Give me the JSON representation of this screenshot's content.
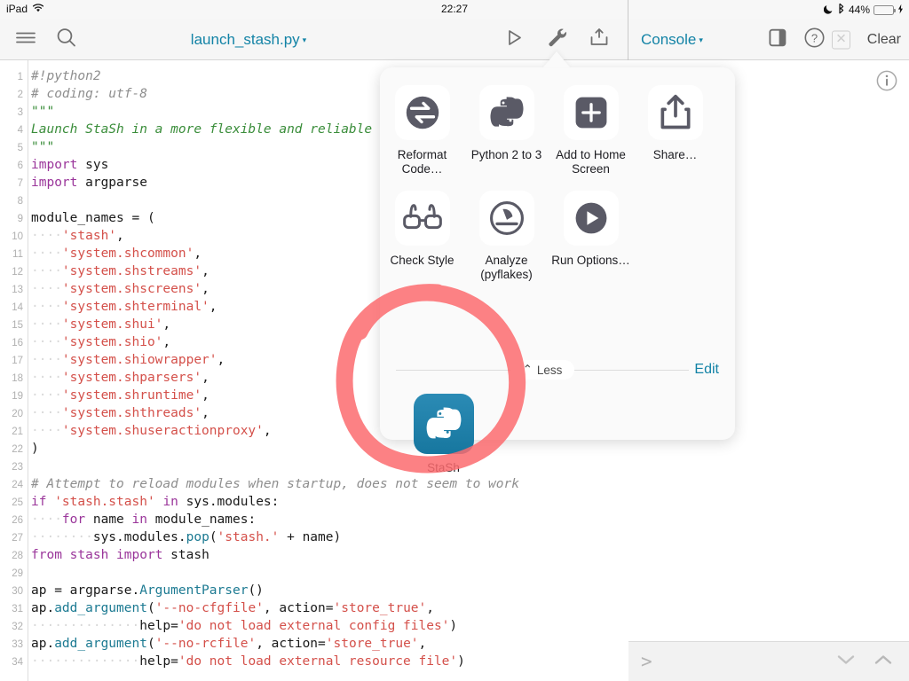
{
  "status_bar": {
    "device": "iPad",
    "wifi_icon": "wifi-icon",
    "time": "22:27",
    "dnd_icon": "moon-icon",
    "bluetooth_icon": "bluetooth-icon",
    "battery_percent": "44%",
    "battery_level": 44,
    "battery_color": "#4cd964",
    "charging_icon": "lightning-bolt-icon"
  },
  "toolbar": {
    "menu_icon": "hamburger-menu-icon",
    "search_icon": "search-icon",
    "document_title": "launch_stash.py",
    "title_caret": "▾",
    "run_icon": "play-triangle-icon",
    "wrench_icon": "wrench-icon",
    "export_icon": "add-to-tray-icon",
    "console_title": "Console",
    "console_caret": "▾",
    "panel_toggle_icon": "sidebar-toggle-icon",
    "help_icon": "question-mark-circle-icon",
    "close_icon": "x-box-icon",
    "clear_label": "Clear",
    "accent_color": "#1383a6"
  },
  "console": {
    "info_icon": "info-circle-icon",
    "prompt": ">",
    "history_down_icon": "chevron-down-icon",
    "history_up_icon": "chevron-up-icon"
  },
  "popover": {
    "actions": [
      {
        "label": "Reformat Code…",
        "icon": "reformat-arrows-icon"
      },
      {
        "label": "Python 2 to 3",
        "icon": "python-logo-icon"
      },
      {
        "label": "Add to Home Screen",
        "icon": "plus-square-icon"
      },
      {
        "label": "Share…",
        "icon": "share-upload-icon"
      },
      {
        "label": "Check Style",
        "icon": "glasses-icon"
      },
      {
        "label": "Analyze (pyflakes)",
        "icon": "gauge-meter-icon"
      },
      {
        "label": "Run Options…",
        "icon": "play-circle-icon"
      }
    ],
    "less_label": "Less",
    "less_caret": "⌃",
    "edit_label": "Edit",
    "script": {
      "label": "StaSh",
      "icon": "python-logo-icon",
      "tile_color": "#17779f"
    }
  },
  "annotation": {
    "shape": "hand-drawn-circle",
    "color": "#fb6b6e",
    "target": "StaSh"
  },
  "editor": {
    "syntax_colors": {
      "comment": "#8e8e8e",
      "docstring": "#3a8d3a",
      "keyword": "#9a359a",
      "string": "#d4504a",
      "function": "#1c7a92",
      "plain": "#1a1a1a"
    },
    "lines": [
      {
        "n": "1",
        "tokens": [
          {
            "t": "#!python2",
            "c": "com"
          }
        ]
      },
      {
        "n": "2",
        "tokens": [
          {
            "t": "# coding: utf‐8",
            "c": "com"
          }
        ]
      },
      {
        "n": "3",
        "tokens": [
          {
            "t": "\"\"\"",
            "c": "doc"
          }
        ]
      },
      {
        "n": "4",
        "tokens": [
          {
            "t": "Launch StaSh in a more flexible and reliable way",
            "c": "doc"
          }
        ]
      },
      {
        "n": "5",
        "tokens": [
          {
            "t": "\"\"\"",
            "c": "doc"
          }
        ]
      },
      {
        "n": "6",
        "tokens": [
          {
            "t": "import",
            "c": "kw"
          },
          {
            "t": " sys",
            "c": "pl"
          }
        ]
      },
      {
        "n": "7",
        "tokens": [
          {
            "t": "import",
            "c": "kw"
          },
          {
            "t": " argparse",
            "c": "pl"
          }
        ]
      },
      {
        "n": "8",
        "tokens": []
      },
      {
        "n": "9",
        "tokens": [
          {
            "t": "module_names = (",
            "c": "pl"
          }
        ]
      },
      {
        "n": "10",
        "tokens": [
          {
            "t": "····",
            "c": "ind"
          },
          {
            "t": "'stash'",
            "c": "str"
          },
          {
            "t": ",",
            "c": "pl"
          }
        ]
      },
      {
        "n": "11",
        "tokens": [
          {
            "t": "····",
            "c": "ind"
          },
          {
            "t": "'system.shcommon'",
            "c": "str"
          },
          {
            "t": ",",
            "c": "pl"
          }
        ]
      },
      {
        "n": "12",
        "tokens": [
          {
            "t": "····",
            "c": "ind"
          },
          {
            "t": "'system.shstreams'",
            "c": "str"
          },
          {
            "t": ",",
            "c": "pl"
          }
        ]
      },
      {
        "n": "13",
        "tokens": [
          {
            "t": "····",
            "c": "ind"
          },
          {
            "t": "'system.shscreens'",
            "c": "str"
          },
          {
            "t": ",",
            "c": "pl"
          }
        ]
      },
      {
        "n": "14",
        "tokens": [
          {
            "t": "····",
            "c": "ind"
          },
          {
            "t": "'system.shterminal'",
            "c": "str"
          },
          {
            "t": ",",
            "c": "pl"
          }
        ]
      },
      {
        "n": "15",
        "tokens": [
          {
            "t": "····",
            "c": "ind"
          },
          {
            "t": "'system.shui'",
            "c": "str"
          },
          {
            "t": ",",
            "c": "pl"
          }
        ]
      },
      {
        "n": "16",
        "tokens": [
          {
            "t": "····",
            "c": "ind"
          },
          {
            "t": "'system.shio'",
            "c": "str"
          },
          {
            "t": ",",
            "c": "pl"
          }
        ]
      },
      {
        "n": "17",
        "tokens": [
          {
            "t": "····",
            "c": "ind"
          },
          {
            "t": "'system.shiowrapper'",
            "c": "str"
          },
          {
            "t": ",",
            "c": "pl"
          }
        ]
      },
      {
        "n": "18",
        "tokens": [
          {
            "t": "····",
            "c": "ind"
          },
          {
            "t": "'system.shparsers'",
            "c": "str"
          },
          {
            "t": ",",
            "c": "pl"
          }
        ]
      },
      {
        "n": "19",
        "tokens": [
          {
            "t": "····",
            "c": "ind"
          },
          {
            "t": "'system.shruntime'",
            "c": "str"
          },
          {
            "t": ",",
            "c": "pl"
          }
        ]
      },
      {
        "n": "20",
        "tokens": [
          {
            "t": "····",
            "c": "ind"
          },
          {
            "t": "'system.shthreads'",
            "c": "str"
          },
          {
            "t": ",",
            "c": "pl"
          }
        ]
      },
      {
        "n": "21",
        "tokens": [
          {
            "t": "····",
            "c": "ind"
          },
          {
            "t": "'system.shuseractionproxy'",
            "c": "str"
          },
          {
            "t": ",",
            "c": "pl"
          }
        ]
      },
      {
        "n": "22",
        "tokens": [
          {
            "t": ")",
            "c": "pl"
          }
        ]
      },
      {
        "n": "23",
        "tokens": []
      },
      {
        "n": "24",
        "tokens": [
          {
            "t": "# Attempt to reload modules when startup, does not seem to work",
            "c": "com"
          }
        ]
      },
      {
        "n": "25",
        "tokens": [
          {
            "t": "if ",
            "c": "kw"
          },
          {
            "t": "'stash.stash'",
            "c": "str"
          },
          {
            "t": " ",
            "c": "pl"
          },
          {
            "t": "in",
            "c": "kw"
          },
          {
            "t": " sys.modules:",
            "c": "pl"
          }
        ]
      },
      {
        "n": "26",
        "tokens": [
          {
            "t": "····",
            "c": "ind"
          },
          {
            "t": "for",
            "c": "kw"
          },
          {
            "t": " name ",
            "c": "pl"
          },
          {
            "t": "in",
            "c": "kw"
          },
          {
            "t": " module_names:",
            "c": "pl"
          }
        ]
      },
      {
        "n": "27",
        "tokens": [
          {
            "t": "········",
            "c": "ind"
          },
          {
            "t": "sys.modules.",
            "c": "pl"
          },
          {
            "t": "pop",
            "c": "fn"
          },
          {
            "t": "(",
            "c": "pl"
          },
          {
            "t": "'stash.'",
            "c": "str"
          },
          {
            "t": " + name)",
            "c": "pl"
          }
        ]
      },
      {
        "n": "28",
        "tokens": [
          {
            "t": "from",
            "c": "kw"
          },
          {
            "t": " ",
            "c": "pl"
          },
          {
            "t": "stash",
            "c": "kw"
          },
          {
            "t": " ",
            "c": "pl"
          },
          {
            "t": "import",
            "c": "kw"
          },
          {
            "t": " stash",
            "c": "pl"
          }
        ]
      },
      {
        "n": "29",
        "tokens": []
      },
      {
        "n": "30",
        "tokens": [
          {
            "t": "ap = argparse.",
            "c": "pl"
          },
          {
            "t": "ArgumentParser",
            "c": "fn"
          },
          {
            "t": "()",
            "c": "pl"
          }
        ]
      },
      {
        "n": "31",
        "tokens": [
          {
            "t": "ap.",
            "c": "pl"
          },
          {
            "t": "add_argument",
            "c": "fn"
          },
          {
            "t": "(",
            "c": "pl"
          },
          {
            "t": "'‐‐no‐cfgfile'",
            "c": "str"
          },
          {
            "t": ", action=",
            "c": "pl"
          },
          {
            "t": "'store_true'",
            "c": "str"
          },
          {
            "t": ",",
            "c": "pl"
          }
        ]
      },
      {
        "n": "32",
        "tokens": [
          {
            "t": "··············",
            "c": "ind"
          },
          {
            "t": "help=",
            "c": "pl"
          },
          {
            "t": "'do not load external config files'",
            "c": "str"
          },
          {
            "t": ")",
            "c": "pl"
          }
        ]
      },
      {
        "n": "33",
        "tokens": [
          {
            "t": "ap.",
            "c": "pl"
          },
          {
            "t": "add_argument",
            "c": "fn"
          },
          {
            "t": "(",
            "c": "pl"
          },
          {
            "t": "'‐‐no‐rcfile'",
            "c": "str"
          },
          {
            "t": ", action=",
            "c": "pl"
          },
          {
            "t": "'store_true'",
            "c": "str"
          },
          {
            "t": ",",
            "c": "pl"
          }
        ]
      },
      {
        "n": "34",
        "tokens": [
          {
            "t": "··············",
            "c": "ind"
          },
          {
            "t": "help=",
            "c": "pl"
          },
          {
            "t": "'do not load external resource file'",
            "c": "str"
          },
          {
            "t": ")",
            "c": "pl"
          }
        ]
      }
    ]
  }
}
